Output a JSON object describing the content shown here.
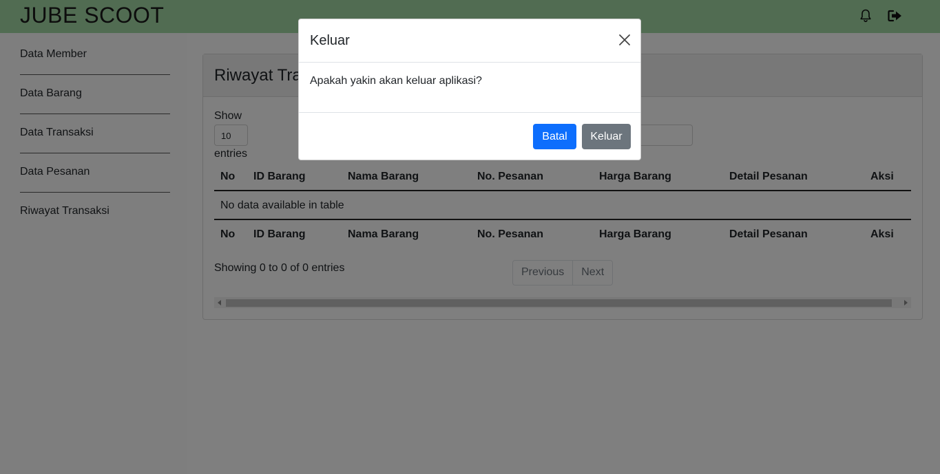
{
  "header": {
    "brand": "JUBE SCOOT",
    "bell_icon": "bell-icon",
    "logout_icon": "logout-icon",
    "background": "#a3d9a5"
  },
  "sidebar": {
    "items": [
      {
        "label": "Data Member"
      },
      {
        "label": "Data Barang"
      },
      {
        "label": "Data Transaksi"
      },
      {
        "label": "Data Pesanan"
      },
      {
        "label": "Riwayat Transaksi"
      }
    ]
  },
  "main": {
    "card_title": "Riwayat Transaksi",
    "show_label": "Show",
    "page_length": "10",
    "entries_label": "entries",
    "table": {
      "columns": [
        "No",
        "ID Barang",
        "Nama Barang",
        "No. Pesanan",
        "Harga Barang",
        "Detail Pesanan",
        "Aksi"
      ],
      "empty_message": "No data available in table"
    },
    "info": "Showing 0 to 0 of 0 entries",
    "pagination": {
      "previous": "Previous",
      "next": "Next"
    }
  },
  "modal": {
    "title": "Keluar",
    "message": "Apakah yakin akan keluar aplikasi?",
    "cancel_label": "Batal",
    "confirm_label": "Keluar",
    "cancel_color": "#0d6efd",
    "confirm_color": "#6c757d",
    "close_icon": "close-icon"
  }
}
